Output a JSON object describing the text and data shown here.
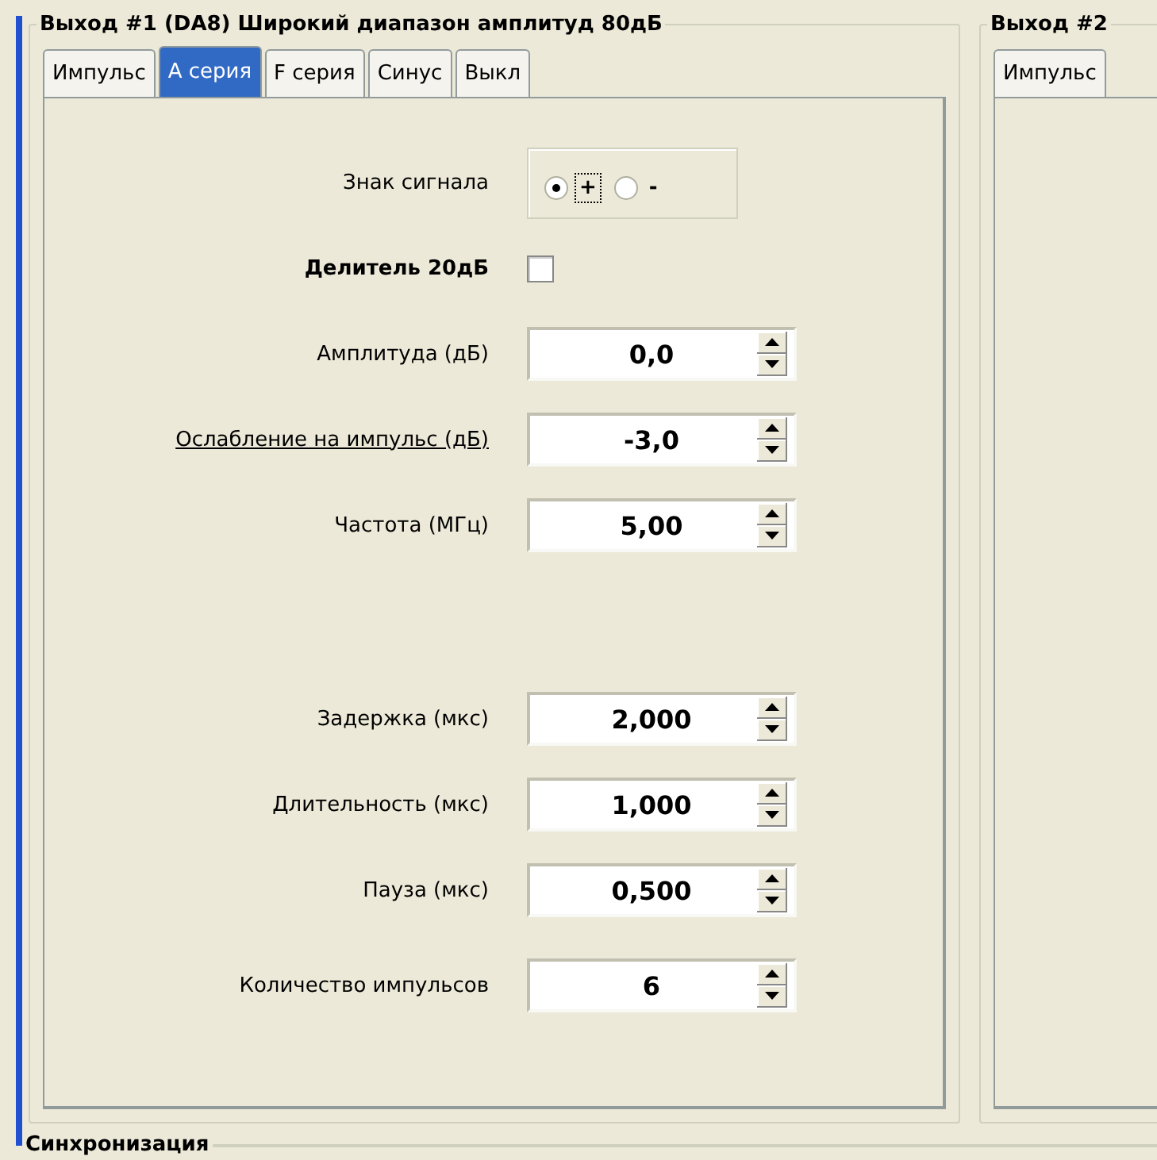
{
  "groups": [
    {
      "title": "Выход #1 (DA8) Широкий диапазон амплитуд 80дБ",
      "tabs": [
        {
          "label": "Импульс",
          "selected": false
        },
        {
          "label": "А серия",
          "selected": true
        },
        {
          "label": "F серия",
          "selected": false
        },
        {
          "label": "Синус",
          "selected": false
        },
        {
          "label": "Выкл",
          "selected": false
        }
      ],
      "sections": [
        [
          {
            "kind": "radio",
            "label": "Знак сигнала",
            "options": [
              {
                "label": "+",
                "selected": true,
                "focused": true
              },
              {
                "label": "-",
                "selected": false,
                "focused": false
              }
            ]
          },
          {
            "kind": "checkbox",
            "label": "Делитель 20дБ",
            "checked": false
          },
          {
            "kind": "spin",
            "label": "Амплитуда (дБ)",
            "value": "0,0",
            "underlined": false
          },
          {
            "kind": "spin",
            "label": "Ослабление на импульс (дБ)",
            "value": "-3,0",
            "underlined": true
          },
          {
            "kind": "spin",
            "label": "Частота (МГц)",
            "value": "5,00",
            "underlined": false
          }
        ],
        [
          {
            "kind": "spin",
            "label": "Задержка (мкс)",
            "value": "2,000",
            "underlined": false
          },
          {
            "kind": "spin",
            "label": "Длительность (мкс)",
            "value": "1,000",
            "underlined": false
          },
          {
            "kind": "spin",
            "label": "Пауза (мкс)",
            "value": "0,500",
            "underlined": false
          }
        ],
        [
          {
            "kind": "spin",
            "label": "Количество импульсов",
            "value": "6",
            "underlined": false
          }
        ]
      ]
    },
    {
      "title": "Выход #2",
      "tabs": [
        {
          "label": "Импульс",
          "selected": false
        }
      ]
    }
  ],
  "bottom_group": {
    "title": "Синхронизация"
  }
}
